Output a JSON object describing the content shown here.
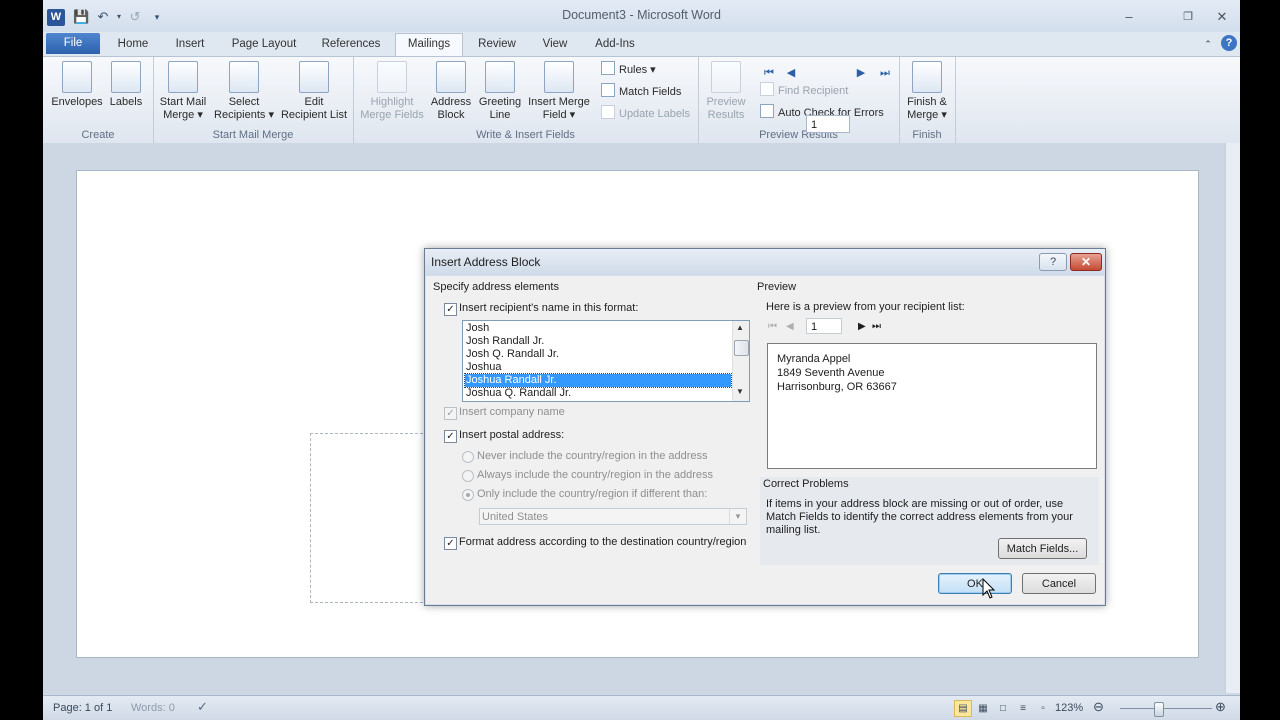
{
  "window": {
    "title": "Document3 - Microsoft Word"
  },
  "colors": {
    "accent": "#2b579a",
    "selection": "#3399ff",
    "file_tab": "#2c62ad"
  },
  "tabs": [
    "File",
    "Home",
    "Insert",
    "Page Layout",
    "References",
    "Mailings",
    "Review",
    "View",
    "Add-Ins"
  ],
  "ribbon": {
    "groups": {
      "create": "Create",
      "start_mail_merge": "Start Mail Merge",
      "write_insert_fields": "Write & Insert Fields",
      "preview_results": "Preview Results",
      "finish": "Finish"
    },
    "buttons": {
      "envelopes": "Envelopes",
      "labels": "Labels",
      "start_mail_merge_1": "Start Mail",
      "start_mail_merge_2": "Merge ▾",
      "select_recipients_1": "Select",
      "select_recipients_2": "Recipients ▾",
      "edit_recipient_1": "Edit",
      "edit_recipient_2": "Recipient List",
      "highlight_1": "Highlight",
      "highlight_2": "Merge Fields",
      "address_block_1": "Address",
      "address_block_2": "Block",
      "greeting_1": "Greeting",
      "greeting_2": "Line",
      "insert_merge_1": "Insert Merge",
      "insert_merge_2": "Field ▾",
      "rules": "Rules ▾",
      "match_fields": "Match Fields",
      "update_labels": "Update Labels",
      "preview_results_1": "Preview",
      "preview_results_2": "Results",
      "record_number": "1",
      "find_recipient": "Find Recipient",
      "auto_check": "Auto Check for Errors",
      "finish_merge_1": "Finish &",
      "finish_merge_2": "Merge ▾"
    }
  },
  "statusbar": {
    "page": "Page: 1 of 1",
    "words": "Words: 0",
    "zoom": "123%"
  },
  "dialog": {
    "title": "Insert Address Block",
    "specify_heading": "Specify address elements",
    "insert_name_label": "Insert recipient's name in this format:",
    "name_formats": [
      "Josh",
      "Josh Randall Jr.",
      "Josh Q. Randall Jr.",
      "Joshua",
      "Joshua Randall Jr.",
      "Joshua Q. Randall Jr."
    ],
    "selected_name_format": "Joshua Randall Jr.",
    "insert_company_label": "Insert company name",
    "insert_postal_label": "Insert postal address:",
    "radio_never": "Never include the country/region in the address",
    "radio_always": "Always include the country/region in the address",
    "radio_only": "Only include the country/region if different than:",
    "country_value": "United States",
    "format_address_label": "Format address according to the destination country/region",
    "preview_heading": "Preview",
    "preview_intro": "Here is a preview from your recipient list:",
    "preview_record": "1",
    "preview_lines": [
      "Myranda Appel",
      "1849 Seventh Avenue",
      "Harrisonburg, OR 63667"
    ],
    "correct_heading": "Correct Problems",
    "correct_text_1": "If items in your address block are missing or out of order, use",
    "correct_text_2": "Match Fields to identify the correct address elements from your",
    "correct_text_3": "mailing list.",
    "match_fields_button": "Match Fields...",
    "ok_button": "OK",
    "cancel_button": "Cancel",
    "help_glyph": "?"
  }
}
